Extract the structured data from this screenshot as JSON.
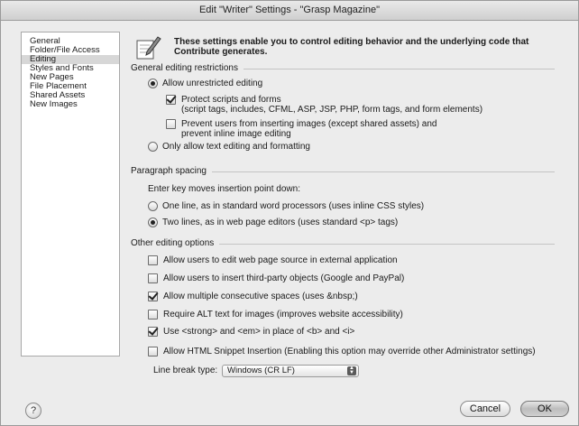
{
  "window": {
    "title": "Edit \"Writer\" Settings - \"Grasp Magazine\""
  },
  "sidebar": {
    "items": [
      {
        "label": "General"
      },
      {
        "label": "Folder/File Access"
      },
      {
        "label": "Editing",
        "selected": true
      },
      {
        "label": "Styles and Fonts"
      },
      {
        "label": "New Pages"
      },
      {
        "label": "File Placement"
      },
      {
        "label": "Shared Assets"
      },
      {
        "label": "New Images"
      }
    ]
  },
  "intro": {
    "line1": "These settings enable you to control editing behavior and the underlying code that",
    "line2": "Contribute generates."
  },
  "general": {
    "heading": "General editing restrictions",
    "allow_unrestricted": {
      "label": "Allow unrestricted editing",
      "selected": true
    },
    "protect_scripts": {
      "label": "Protect scripts and forms",
      "detail": "(script tags, includes, CFML, ASP, JSP, PHP, form tags, and form elements)",
      "checked": true
    },
    "prevent_images": {
      "line1": "Prevent users from inserting images (except shared assets) and",
      "line2": "prevent inline image editing",
      "checked": false
    },
    "only_text": {
      "label": "Only allow text editing and formatting",
      "selected": false
    }
  },
  "paragraph": {
    "heading": "Paragraph spacing",
    "prompt": "Enter key moves insertion point down:",
    "one_line": {
      "label": "One line, as in standard word processors (uses inline CSS styles)",
      "selected": false
    },
    "two_lines": {
      "label": "Two lines, as in web page editors (uses standard <p> tags)",
      "selected": true
    }
  },
  "other": {
    "heading": "Other editing options",
    "options": [
      {
        "label": "Allow users to edit web page source in external application",
        "checked": false
      },
      {
        "label": "Allow users to insert third-party objects (Google and PayPal)",
        "checked": false
      },
      {
        "label": "Allow multiple consecutive spaces (uses &nbsp;)",
        "checked": true
      },
      {
        "label": "Require ALT text for images (improves website accessibility)",
        "checked": false
      },
      {
        "label": "Use <strong> and <em> in place of <b> and <i>",
        "checked": true
      },
      {
        "label": "Allow HTML Snippet Insertion (Enabling this option may override other Administrator settings)",
        "checked": false
      }
    ],
    "line_break_label": "Line break type:",
    "line_break_value": "Windows (CR LF)"
  },
  "footer": {
    "help": "?",
    "cancel": "Cancel",
    "ok": "OK"
  },
  "colors": {
    "background": "#ececec",
    "selection": "#d7d7d7"
  }
}
